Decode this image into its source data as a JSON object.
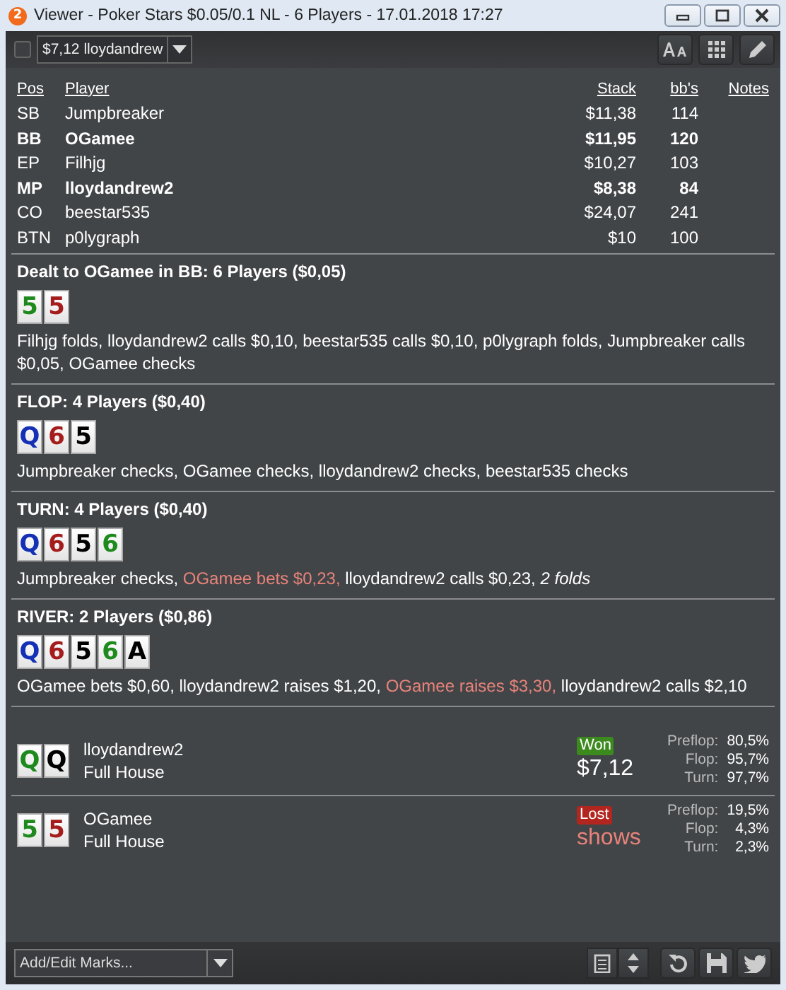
{
  "window": {
    "logo_text": "2",
    "title": "Viewer - Poker Stars $0.05/0.1 NL - 6 Players - 17.01.2018 17:27"
  },
  "toolbar": {
    "checked": false,
    "selector_value": "$7,12 lloydandrew"
  },
  "table": {
    "columns": [
      "Pos",
      "Player",
      "Stack",
      "bb's",
      "Notes"
    ],
    "rows": [
      {
        "pos": "SB",
        "player": "Jumpbreaker",
        "stack": "$11,38",
        "bbs": "114",
        "highlighted": false
      },
      {
        "pos": "BB",
        "player": "OGamee",
        "stack": "$11,95",
        "bbs": "120",
        "highlighted": true
      },
      {
        "pos": "EP",
        "player": "Filhjg",
        "stack": "$10,27",
        "bbs": "103",
        "highlighted": false
      },
      {
        "pos": "MP",
        "player": "lloydandrew2",
        "stack": "$8,38",
        "bbs": "84",
        "highlighted": true
      },
      {
        "pos": "CO",
        "player": "beestar535",
        "stack": "$24,07",
        "bbs": "241",
        "highlighted": false
      },
      {
        "pos": "BTN",
        "player": "p0lygraph",
        "stack": "$10",
        "bbs": "100",
        "highlighted": false
      }
    ]
  },
  "streets": [
    {
      "heading": "Dealt to OGamee in BB: 6 Players ($0,05)",
      "cards": [
        {
          "rank": "5",
          "color": "#1e8a1e"
        },
        {
          "rank": "5",
          "color": "#a51c1c"
        }
      ],
      "actions": [
        {
          "kind": "normal",
          "text": "Filhjg folds, lloydandrew2 calls $0,10, beestar535 calls $0,10, p0lygraph folds, Jumpbreaker calls $0,05, OGamee checks"
        }
      ]
    },
    {
      "heading": "FLOP: 4 Players ($0,40)",
      "cards": [
        {
          "rank": "Q",
          "color": "#1430b4"
        },
        {
          "rank": "6",
          "color": "#a51c1c"
        },
        {
          "rank": "5",
          "color": "#000000"
        }
      ],
      "actions": [
        {
          "kind": "normal",
          "text": "Jumpbreaker checks, OGamee checks, lloydandrew2 checks, beestar535 checks"
        }
      ]
    },
    {
      "heading": "TURN: 4 Players ($0,40)",
      "cards": [
        {
          "rank": "Q",
          "color": "#1430b4"
        },
        {
          "rank": "6",
          "color": "#a51c1c"
        },
        {
          "rank": "5",
          "color": "#000000"
        },
        {
          "rank": "6",
          "color": "#1e8a1e"
        }
      ],
      "actions": [
        {
          "kind": "normal",
          "text": "Jumpbreaker checks,"
        },
        {
          "kind": "hero",
          "text": "OGamee bets $0,23,"
        },
        {
          "kind": "normal",
          "text": "lloydandrew2 calls $0,23,"
        },
        {
          "kind": "summary",
          "text": "2 folds"
        }
      ]
    },
    {
      "heading": "RIVER: 2 Players ($0,86)",
      "cards": [
        {
          "rank": "Q",
          "color": "#1430b4"
        },
        {
          "rank": "6",
          "color": "#a51c1c"
        },
        {
          "rank": "5",
          "color": "#000000"
        },
        {
          "rank": "6",
          "color": "#1e8a1e"
        },
        {
          "rank": "A",
          "color": "#000000"
        }
      ],
      "actions": [
        {
          "kind": "normal",
          "text": "OGamee bets $0,60, lloydandrew2 raises $1,20,"
        },
        {
          "kind": "hero",
          "text": "OGamee raises $3,30,"
        },
        {
          "kind": "normal",
          "text": "lloydandrew2 calls $2,10"
        }
      ]
    }
  ],
  "results": [
    {
      "cards": [
        {
          "rank": "Q",
          "color": "#1e8a1e"
        },
        {
          "rank": "Q",
          "color": "#000000"
        }
      ],
      "player": "lloydandrew2",
      "hand": "Full House",
      "won": true,
      "badge": "Won",
      "amount": "$7,12",
      "equity": [
        {
          "label": "Preflop:",
          "value": "80,5%"
        },
        {
          "label": "Flop:",
          "value": "95,7%"
        },
        {
          "label": "Turn:",
          "value": "97,7%"
        }
      ]
    },
    {
      "cards": [
        {
          "rank": "5",
          "color": "#1e8a1e"
        },
        {
          "rank": "5",
          "color": "#a51c1c"
        }
      ],
      "player": "OGamee",
      "hand": "Full House",
      "won": false,
      "badge": "Lost",
      "amount": "shows",
      "equity": [
        {
          "label": "Preflop:",
          "value": "19,5%"
        },
        {
          "label": "Flop:",
          "value": "4,3%"
        },
        {
          "label": "Turn:",
          "value": "2,3%"
        }
      ]
    }
  ],
  "bottom_bar": {
    "marks_placeholder": "Add/Edit Marks..."
  }
}
